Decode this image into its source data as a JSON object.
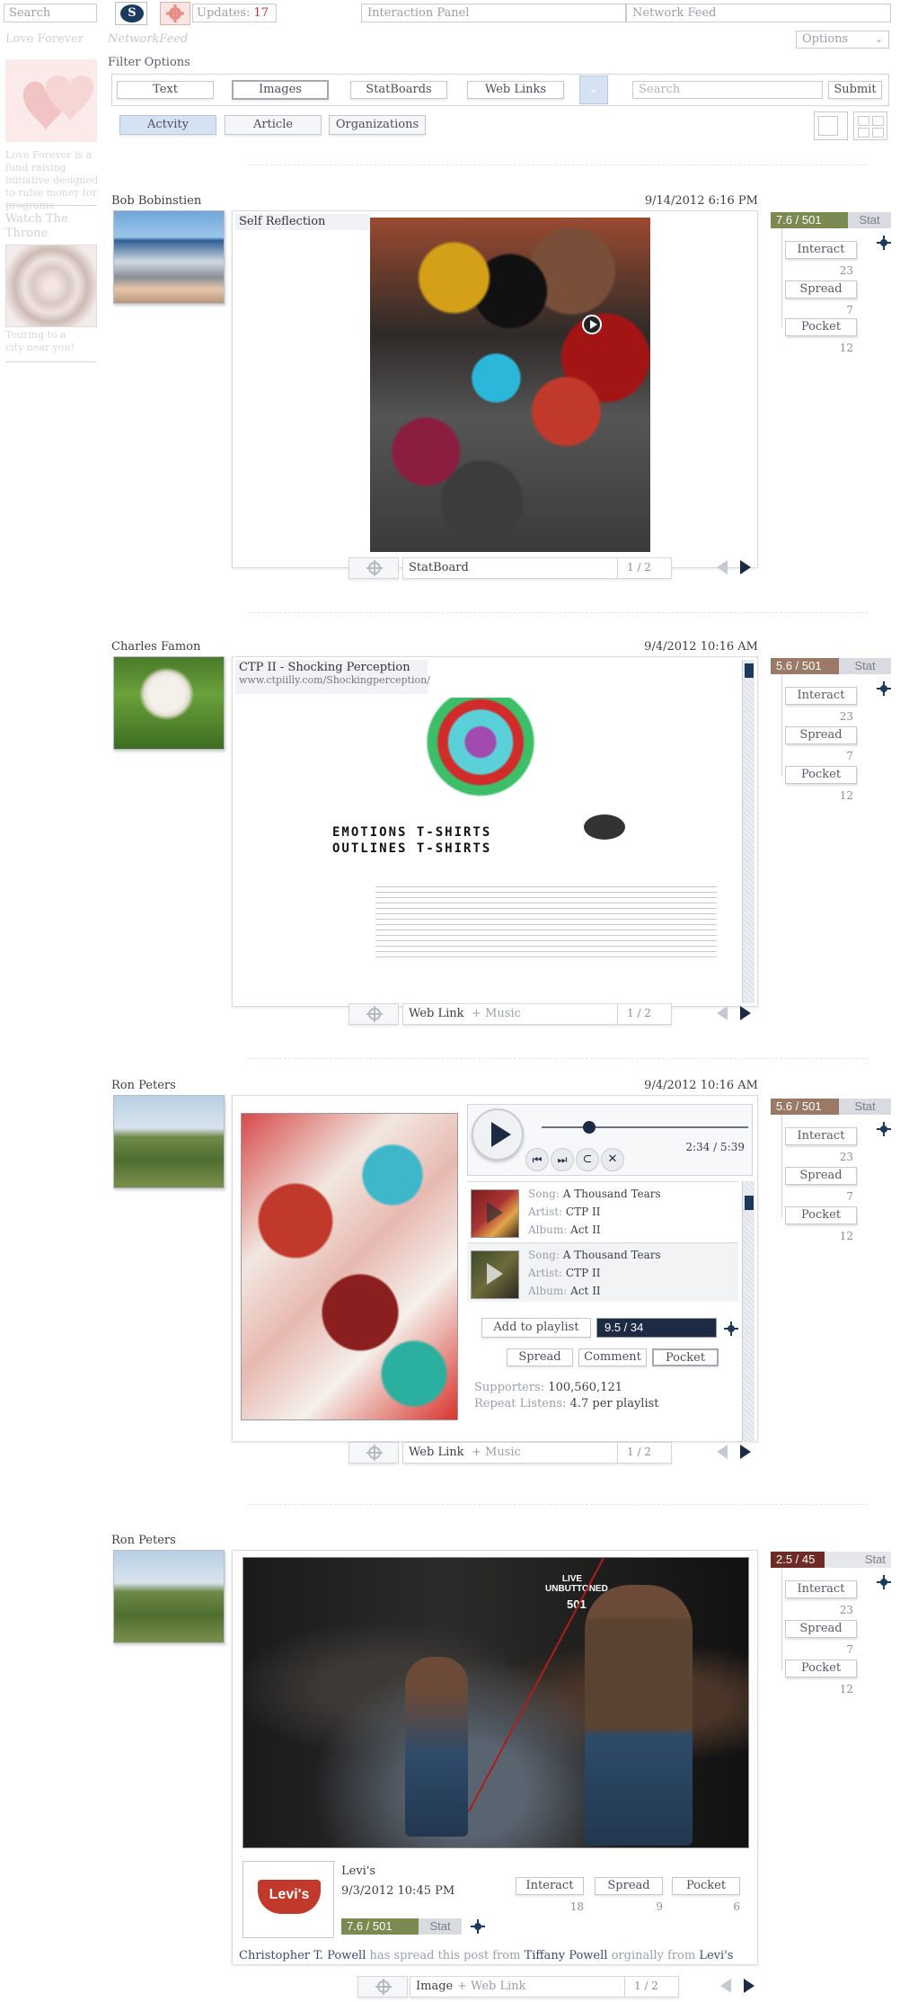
{
  "topbar": {
    "search_placeholder": "Search",
    "logo_letter": "S",
    "updates_label": "Updates:",
    "updates_count": "17",
    "interaction_panel": "Interaction Panel",
    "network_feed": "Network Feed"
  },
  "left_sidebar": {
    "title1": "Love Forever",
    "desc1": "Love Forever is a fund raising initiative designed to raise money for programs",
    "title2": "Watch The Throne",
    "desc2": "Touring to a city near you!"
  },
  "header": {
    "section_label": "NetworkFeed",
    "options_label": "Options",
    "filter_label": "Filter Options",
    "filters_row1": [
      "Text",
      "Images",
      "StatBoards",
      "Web Links"
    ],
    "search_placeholder": "Search",
    "submit_label": "Submit",
    "filters_row2": [
      "Actvity",
      "Article",
      "Organizations"
    ]
  },
  "posts": [
    {
      "author": "Bob Bobinstien",
      "date": "9/14/2012 6:16 PM",
      "content_title": "Self Reflection",
      "stat_score": "7.6 / 501",
      "stat_label": "Stat",
      "stat_color": "#7b8a50",
      "actions": [
        {
          "label": "Interact",
          "count": "23"
        },
        {
          "label": "Spread",
          "count": "7"
        },
        {
          "label": "Pocket",
          "count": "12"
        }
      ],
      "footer_type": "StatBoard",
      "footer_sub": "",
      "page": "1 / 2"
    },
    {
      "author": "Charles Famon",
      "date": "9/4/2012 10:16 AM",
      "content_title": "CTP II - Shocking Perception",
      "content_url": "www.ctpiilly.com/Shockingperception/",
      "web_heading1": "Emotions T-shirts",
      "web_heading2": "Outlines T-shirts",
      "stat_score": "5.6 / 501",
      "stat_label": "Stat",
      "stat_color": "#9a7a66",
      "actions": [
        {
          "label": "Interact",
          "count": "23"
        },
        {
          "label": "Spread",
          "count": "7"
        },
        {
          "label": "Pocket",
          "count": "12"
        }
      ],
      "footer_type": "Web Link",
      "footer_sub": "+ Music",
      "page": "1 / 2"
    },
    {
      "author": "Ron Peters",
      "date": "9/4/2012 10:16 AM",
      "player_time": "2:34 / 5:39",
      "songs": [
        {
          "song_label": "Song:",
          "song": "A Thousand Tears",
          "artist_label": "Artist:",
          "artist": "CTP II",
          "album_label": "Album:",
          "album": "Act II"
        },
        {
          "song_label": "Song:",
          "song": "A Thousand Tears",
          "artist_label": "Artist:",
          "artist": "CTP II",
          "album_label": "Album:",
          "album": "Act II"
        }
      ],
      "add_playlist": "Add to playlist",
      "inner_stat": "9.5 / 34",
      "inner_actions": [
        "Spread",
        "Comment",
        "Pocket"
      ],
      "supporters_label": "Supporters:",
      "supporters": "100,560,121",
      "repeat_label": "Repeat Listens:",
      "repeat": "4.7 per playlist",
      "stat_score": "5.6 / 501",
      "stat_label": "Stat",
      "stat_color": "#9a7a66",
      "actions": [
        {
          "label": "Interact",
          "count": "23"
        },
        {
          "label": "Spread",
          "count": "7"
        },
        {
          "label": "Pocket",
          "count": "12"
        }
      ],
      "footer_type": "Web Link",
      "footer_sub": "+ Music",
      "page": "1 / 2"
    },
    {
      "author": "Ron Peters",
      "date": "",
      "ad_brand_big": "LIVE UNBUTTONED",
      "ad_number": "501",
      "brand": "Levi's",
      "brand_logo": "Levi's",
      "brand_date": "9/3/2012 10:45 PM",
      "brand_stat": "7.6 / 501",
      "brand_stat_label": "Stat",
      "brand_actions": [
        {
          "label": "Interact",
          "count": "18"
        },
        {
          "label": "Spread",
          "count": "9"
        },
        {
          "label": "Pocket",
          "count": "6"
        }
      ],
      "spread_user": "Christopher T. Powell",
      "spread_text1": "has spread this post from",
      "spread_from": "Tiffany Powell",
      "spread_text2": "orginally from",
      "spread_origin": "Levi's",
      "stat_score": "2.5 / 45",
      "stat_label": "Stat",
      "stat_color": "#6e2b25",
      "actions": [
        {
          "label": "Interact",
          "count": "23"
        },
        {
          "label": "Spread",
          "count": "7"
        },
        {
          "label": "Pocket",
          "count": "12"
        }
      ],
      "footer_type": "Image",
      "footer_sub": "+ Web Link",
      "page": "1 / 2"
    }
  ],
  "colors": {
    "accent_red": "#c0392b",
    "dark_blue": "#1c3a5e",
    "light_blue": "#d4e2f2"
  }
}
